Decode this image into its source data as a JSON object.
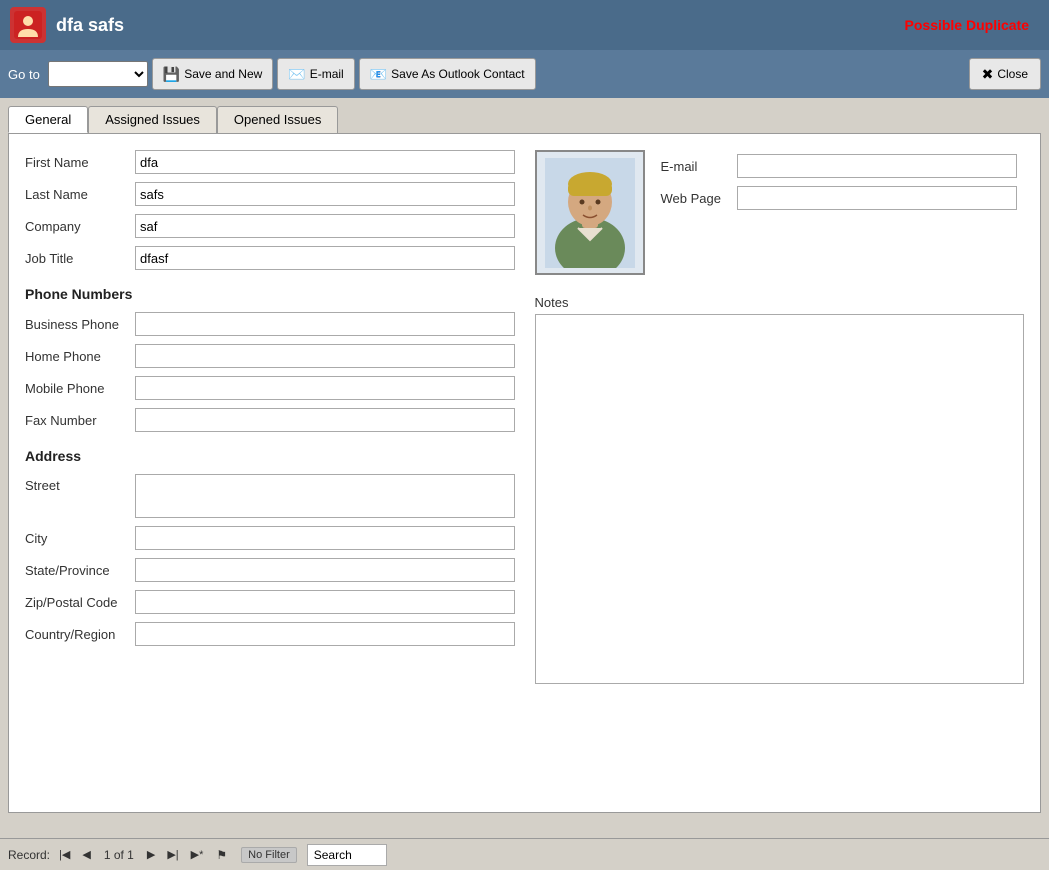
{
  "title": {
    "icon_label": "contact-icon",
    "name": "dfa safs",
    "possible_duplicate": "Possible Duplicate"
  },
  "toolbar": {
    "goto_label": "Go to",
    "save_new_label": "Save and New",
    "email_label": "E-mail",
    "save_outlook_label": "Save As Outlook Contact",
    "close_label": "Close"
  },
  "tabs": [
    {
      "id": "general",
      "label": "General",
      "active": true
    },
    {
      "id": "assigned",
      "label": "Assigned Issues",
      "active": false
    },
    {
      "id": "opened",
      "label": "Opened Issues",
      "active": false
    }
  ],
  "form": {
    "fields": {
      "first_name_label": "First Name",
      "first_name_value": "dfa",
      "last_name_label": "Last Name",
      "last_name_value": "safs",
      "company_label": "Company",
      "company_value": "saf",
      "job_title_label": "Job Title",
      "job_title_value": "dfasf"
    },
    "phone_section_heading": "Phone Numbers",
    "phone_fields": {
      "business_label": "Business Phone",
      "business_value": "",
      "home_label": "Home Phone",
      "home_value": "",
      "mobile_label": "Mobile Phone",
      "mobile_value": "",
      "fax_label": "Fax Number",
      "fax_value": ""
    },
    "address_section_heading": "Address",
    "address_fields": {
      "street_label": "Street",
      "street_value": "",
      "city_label": "City",
      "city_value": "",
      "state_label": "State/Province",
      "state_value": "",
      "zip_label": "Zip/Postal Code",
      "zip_value": "",
      "country_label": "Country/Region",
      "country_value": ""
    },
    "right_fields": {
      "email_label": "E-mail",
      "email_value": "",
      "webpage_label": "Web Page",
      "webpage_value": ""
    },
    "notes_label": "Notes",
    "notes_value": ""
  },
  "statusbar": {
    "record_label": "Record:",
    "record_position": "1 of 1",
    "no_filter_label": "No Filter",
    "search_placeholder": "Search"
  }
}
